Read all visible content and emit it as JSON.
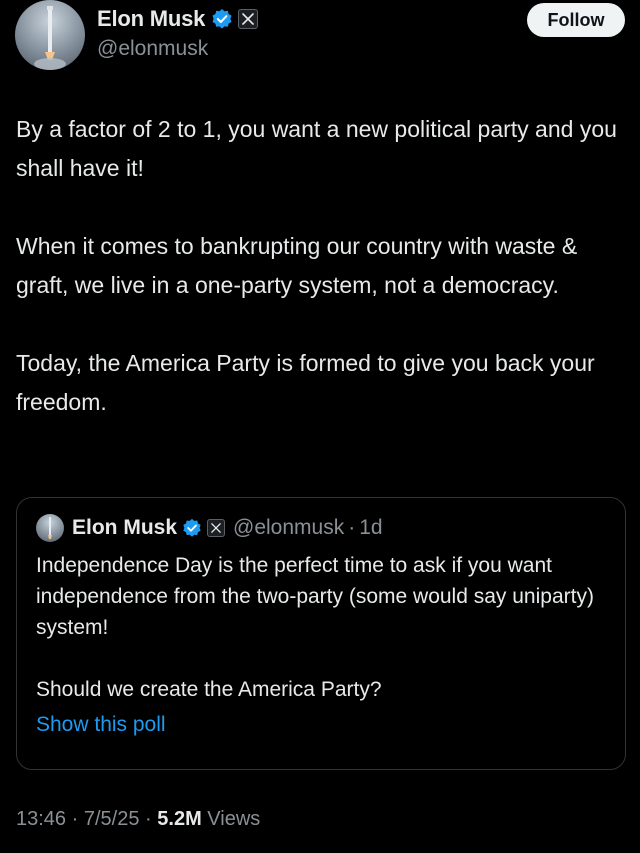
{
  "author": {
    "display_name": "Elon Musk",
    "handle": "@elonmusk",
    "verified_icon": "verified-badge-icon",
    "affiliation_icon": "x-logo-icon"
  },
  "follow_button": {
    "label": "Follow"
  },
  "tweet": {
    "paragraphs": [
      "By a factor of 2 to 1, you want a new political party and you shall have it!",
      "When it comes to bankrupting our country with waste & graft, we live in a one-party system, not a democracy.",
      "Today, the America Party is formed to give you back your freedom."
    ]
  },
  "quoted_tweet": {
    "display_name": "Elon Musk",
    "handle": "@elonmusk",
    "separator": "·",
    "age": "1d",
    "paragraphs": [
      "Independence Day is the perfect time to ask if you want independence from the two-party (some would say uniparty) system!",
      "Should we create the America Party?"
    ],
    "link_label": "Show this poll"
  },
  "footer": {
    "time": "13:46",
    "separator": "·",
    "date": "7/5/25",
    "views_count": "5.2M",
    "views_label": "Views"
  },
  "colors": {
    "background": "#000000",
    "text_primary": "#e7e9ea",
    "text_secondary": "#8b9095",
    "link": "#1d9bf0",
    "verified": "#1d9bf0",
    "border": "#2f3336"
  }
}
